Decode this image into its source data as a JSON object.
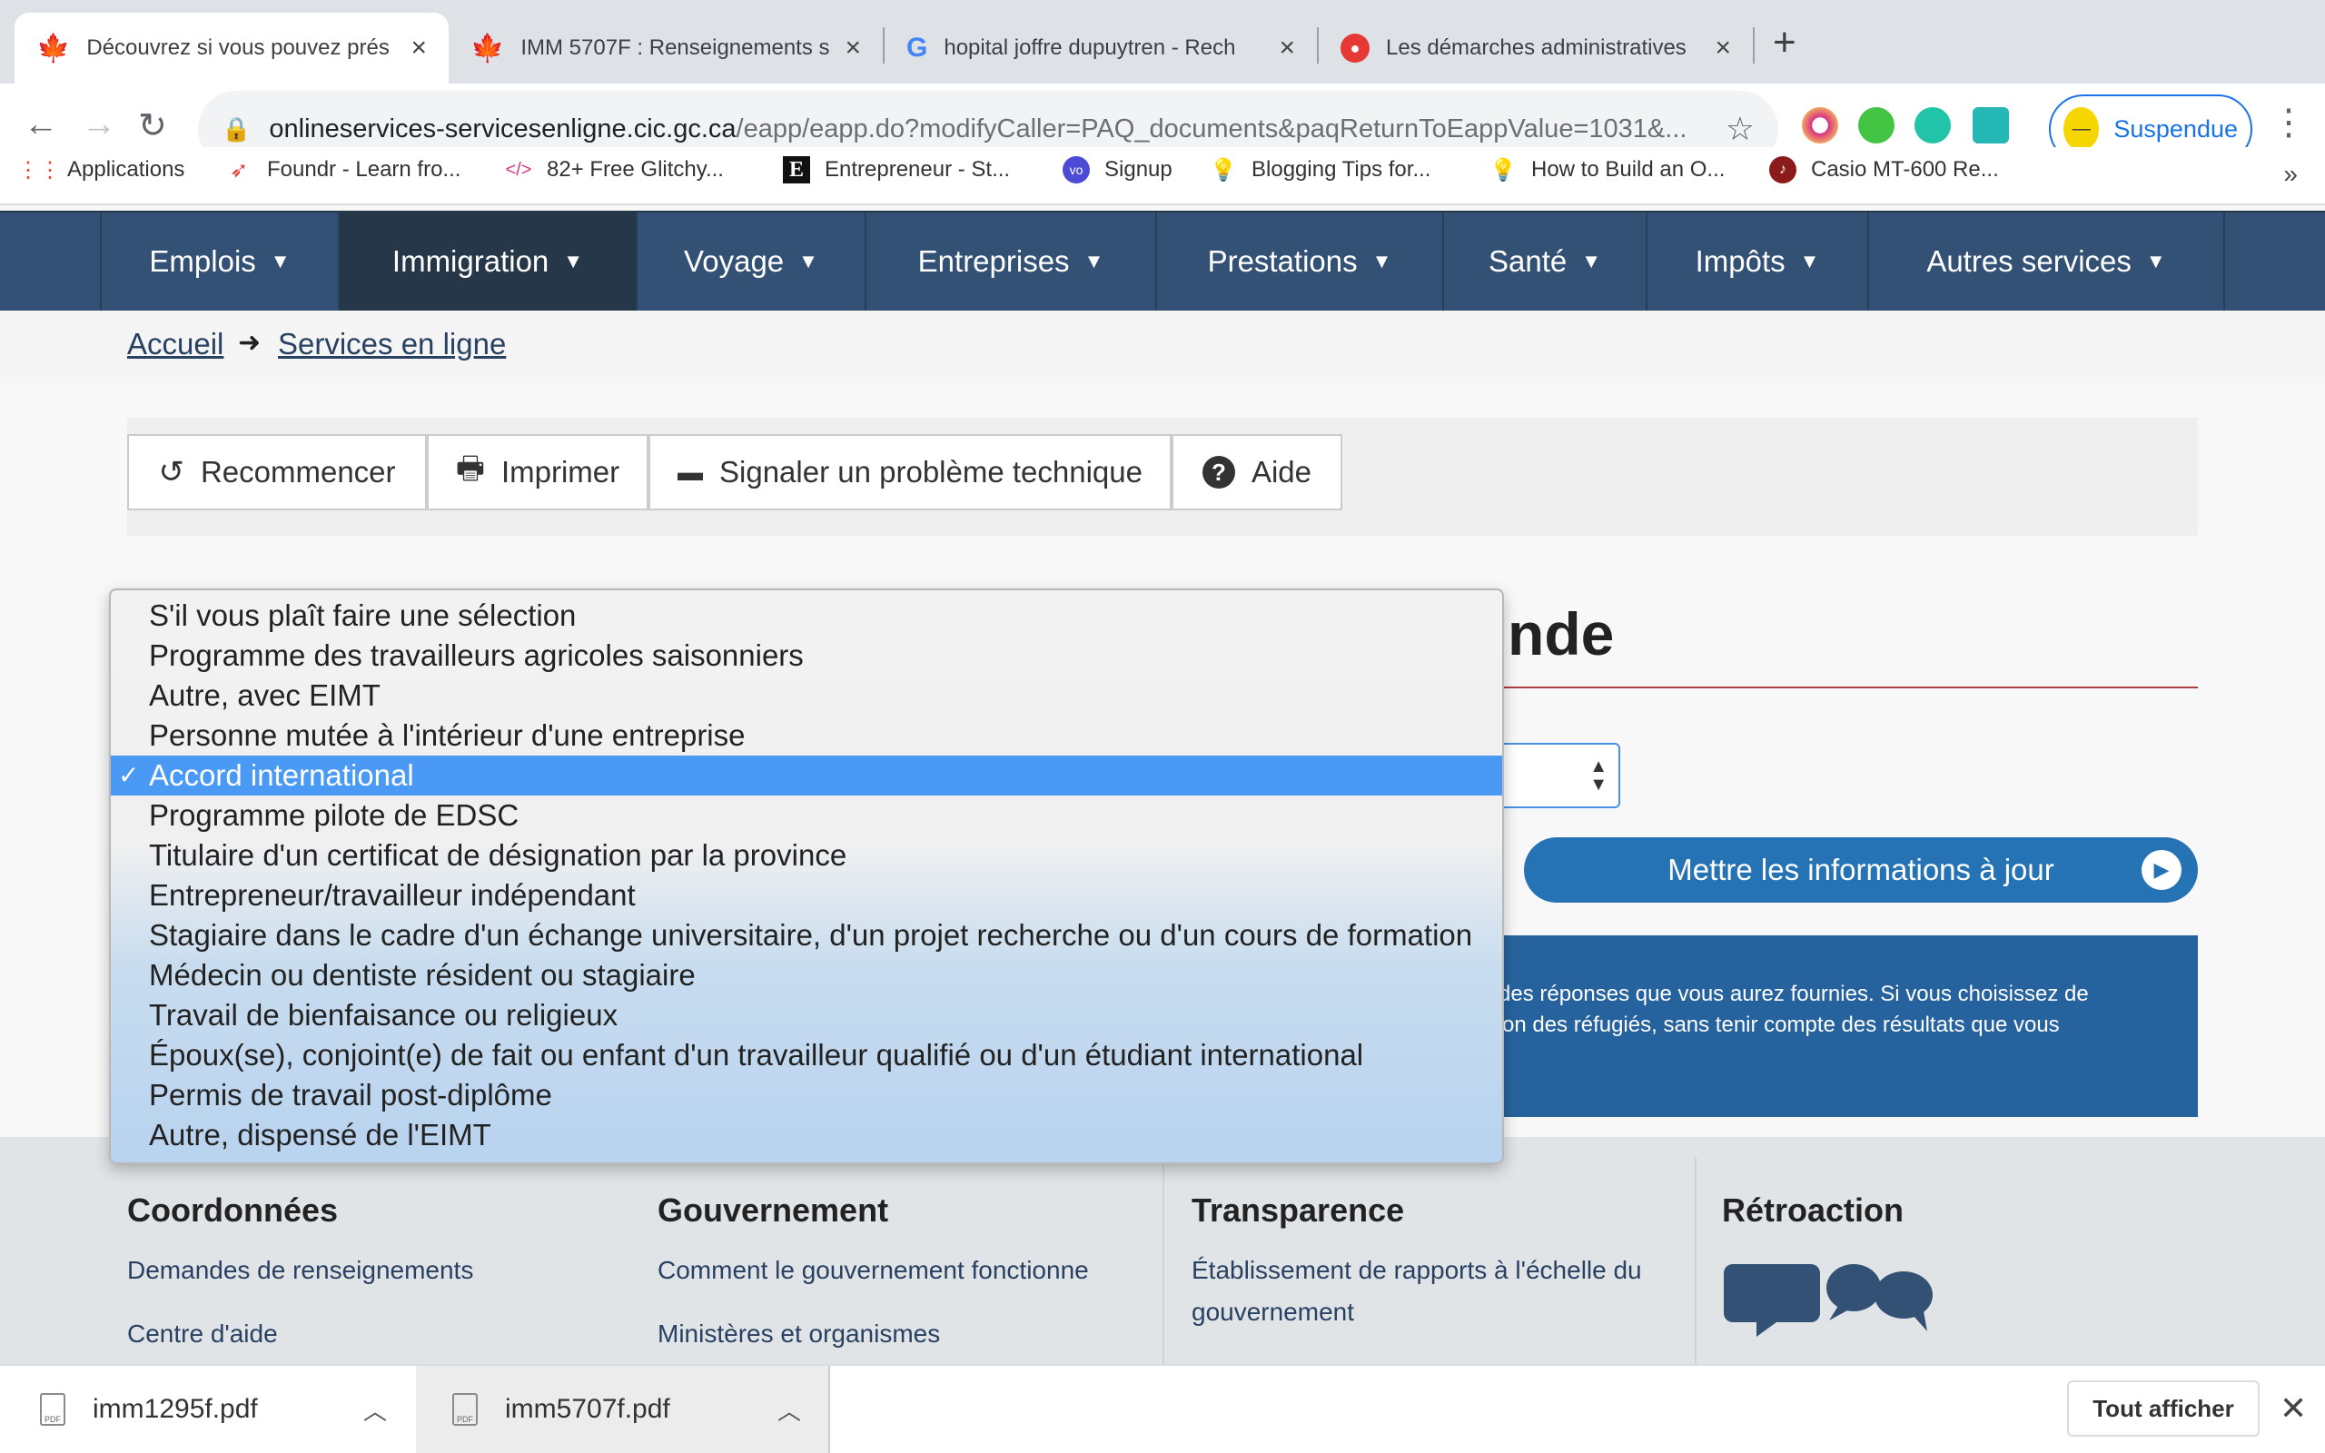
{
  "browser": {
    "tabs": [
      {
        "title": "Découvrez si vous pouvez prés",
        "favicon": "maple-leaf-icon",
        "active": true
      },
      {
        "title": "IMM 5707F : Renseignements s",
        "favicon": "maple-leaf-icon",
        "active": false
      },
      {
        "title": "hopital joffre dupuytren - Rech",
        "favicon": "google-icon",
        "active": false
      },
      {
        "title": "Les démarches administratives",
        "favicon": "pin-icon",
        "active": false
      }
    ],
    "new_tab": "+",
    "url_host": "onlineservices-servicesenligne.cic.gc.ca",
    "url_path": "/eapp/eapp.do?modifyCaller=PAQ_documents&paqReturnToEappValue=1031&...",
    "profile_label": "Suspendue",
    "bookmarks": [
      {
        "label": "Applications",
        "icon": "apps-grid-icon"
      },
      {
        "label": "Foundr - Learn fro...",
        "icon": "rocket-icon"
      },
      {
        "label": "82+ Free Glitchy...",
        "icon": "code-icon"
      },
      {
        "label": "Entrepreneur - St...",
        "icon": "e-logo-icon"
      },
      {
        "label": "Signup",
        "icon": "vo-logo-icon"
      },
      {
        "label": "Blogging Tips for...",
        "icon": "bulb-icon"
      },
      {
        "label": "How to Build an O...",
        "icon": "bulb-icon"
      },
      {
        "label": "Casio MT-600 Re...",
        "icon": "music-icon"
      }
    ],
    "bookmarks_more": "»"
  },
  "nav": {
    "items": [
      {
        "label": "Emplois"
      },
      {
        "label": "Immigration"
      },
      {
        "label": "Voyage"
      },
      {
        "label": "Entreprises"
      },
      {
        "label": "Prestations"
      },
      {
        "label": "Santé"
      },
      {
        "label": "Impôts"
      },
      {
        "label": "Autres services"
      }
    ]
  },
  "breadcrumb": {
    "home": "Accueil",
    "current": "Services en ligne"
  },
  "actions": {
    "restart": "Recommencer",
    "print": "Imprimer",
    "report": "Signaler un problème technique",
    "help": "Aide"
  },
  "main": {
    "heading_fragment": "nde",
    "update_button": "Mettre les informations à jour",
    "info_line1": "e des réponses que vous aurez fournies. Si vous choisissez de",
    "info_line2": "ction des réfugiés, sans tenir compte des résultats que vous"
  },
  "dropdown": {
    "selected": "Accord international",
    "options": [
      "S'il vous plaît faire une sélection",
      "Programme des travailleurs agricoles saisonniers",
      "Autre, avec EIMT",
      "Personne mutée à l'intérieur d'une entreprise",
      "Accord international",
      "Programme pilote de EDSC",
      "Titulaire d'un certificat de désignation par la province",
      "Entrepreneur/travailleur indépendant",
      "Stagiaire dans le cadre d'un échange universitaire, d'un projet recherche ou d'un cours de formation",
      "Médecin ou dentiste résident ou stagiaire",
      "Travail de bienfaisance ou religieux",
      "Époux(se), conjoint(e) de fait ou enfant d'un travailleur qualifié ou d'un étudiant international",
      "Permis de travail post-diplôme",
      "Autre, dispensé de l'EIMT"
    ]
  },
  "footer": {
    "col1": {
      "title": "Coordonnées",
      "links": [
        "Demandes de renseignements",
        "Centre d'aide"
      ]
    },
    "col2": {
      "title": "Gouvernement",
      "links": [
        "Comment le gouvernement fonctionne",
        "Ministères et organismes"
      ]
    },
    "col3": {
      "title": "Transparence",
      "links": [
        "Établissement de rapports à l'échelle du",
        "gouvernement"
      ]
    },
    "col4": {
      "title": "Rétroaction"
    }
  },
  "downloads": {
    "files": [
      "imm1295f.pdf",
      "imm5707f.pdf"
    ],
    "show_all": "Tout afficher"
  },
  "colors": {
    "nav_bg": "#335075",
    "nav_current": "#26374a",
    "link": "#284162",
    "selected_option": "#4a9af5",
    "update_button": "#2572b4"
  }
}
